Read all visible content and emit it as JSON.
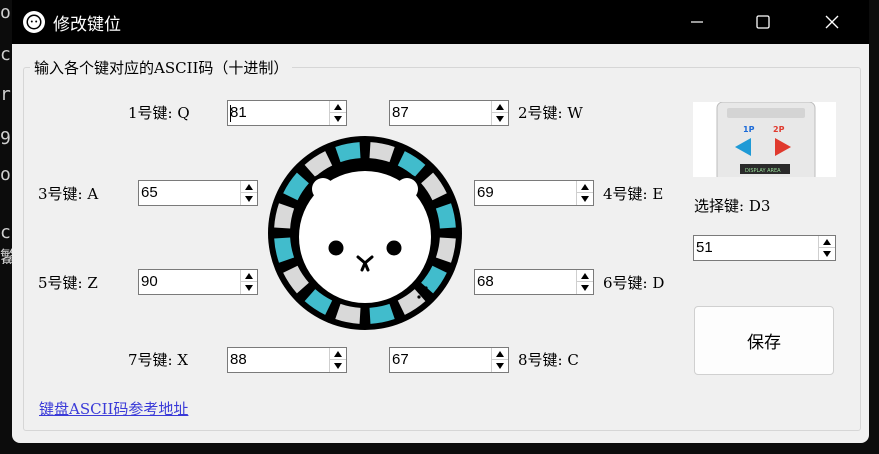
{
  "window": {
    "title": "修改键位",
    "group_title": "输入各个键对应的ASCII码（十进制）"
  },
  "keys": [
    {
      "label": "1号键: Q",
      "value": "81"
    },
    {
      "label": "2号键: W",
      "value": "87"
    },
    {
      "label": "3号键: A",
      "value": "65"
    },
    {
      "label": "4号键: E",
      "value": "69"
    },
    {
      "label": "5号键: Z",
      "value": "90"
    },
    {
      "label": "6号键: D",
      "value": "68"
    },
    {
      "label": "7号键: X",
      "value": "88"
    },
    {
      "label": "8号键: C",
      "value": "67"
    }
  ],
  "select_key": {
    "label": "选择键: D3",
    "value": "51"
  },
  "preview": {
    "left_tag": "1P",
    "right_tag": "2P",
    "display_text": "DISPLAY AREA"
  },
  "save_label": "保存",
  "link_text": "键盘ASCII码参考地址",
  "terminal_chars": [
    "o",
    "c",
    "r",
    "9",
    "o",
    "",
    "c",
    "鰵"
  ],
  "colors": {
    "ring_teal": "#41bccc",
    "ring_gray": "#d9d9d9",
    "link": "#3a3ad8"
  },
  "icons": {
    "app": "bear-ring-icon",
    "minimize": "minimize-icon",
    "maximize": "maximize-icon",
    "close": "close-icon"
  }
}
